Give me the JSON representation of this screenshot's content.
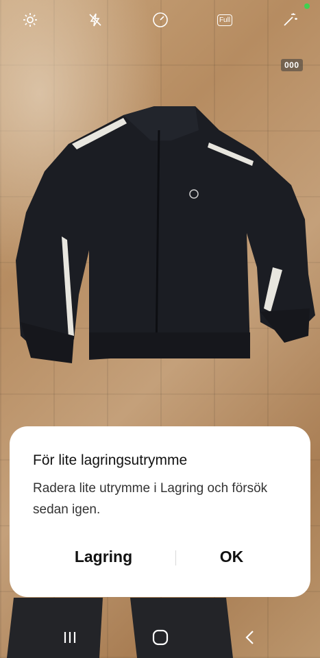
{
  "camera": {
    "icons": [
      "gear-icon",
      "flash-off-icon",
      "timer-icon",
      "aspect-ratio-full-icon",
      "filter-wand-icon"
    ],
    "aspect_label": "Full",
    "counter": "000"
  },
  "dialog": {
    "title": "För lite lagringsutrymme",
    "body": "Radera lite utrymme i Lagring och försök sedan igen.",
    "button_storage": "Lagring",
    "button_ok": "OK"
  },
  "navbar": {
    "icons": [
      "recent-apps-icon",
      "home-icon",
      "back-icon"
    ]
  },
  "colors": {
    "dialog_bg": "#ffffff",
    "status_dot": "#3fd150",
    "jacket": "#1a1c22"
  }
}
